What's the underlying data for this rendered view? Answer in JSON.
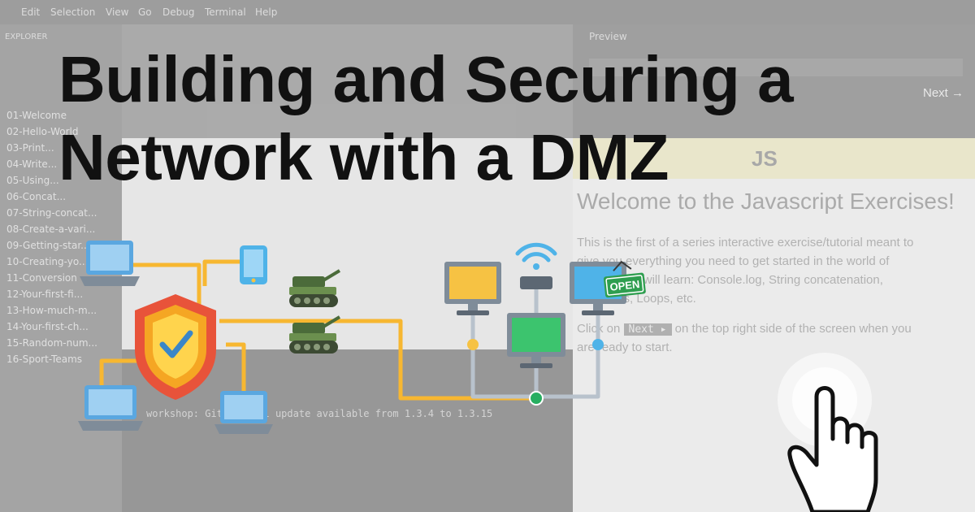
{
  "headline": {
    "line1": "Building and Securing a",
    "line2": "Network with a DMZ"
  },
  "background": {
    "menu": [
      "Edit",
      "Selection",
      "View",
      "Go",
      "Debug",
      "Terminal",
      "Help"
    ],
    "explorer_header": "EXPLORER",
    "files": [
      "01-Welcome",
      "02-Hello-World",
      "03-Print...",
      "04-Write...",
      "05-Using...",
      "06-Concat...",
      "07-String-concat...",
      "08-Create-a-vari...",
      "09-Getting-star...",
      "10-Creating-yo...",
      "11-Conversion",
      "12-Your-first-fi...",
      "13-How-much-m...",
      "14-Your-first-ch...",
      "15-Random-num...",
      "16-Sport-Teams"
    ],
    "terminal_line": "workshop: Gitpod will update available from 1.3.4 to 1.3.15",
    "preview_tab": "Preview",
    "preview_next": "Next →",
    "js_banner": "JS",
    "welcome": "Welcome to the Javascript Exercises!",
    "paragraph": [
      "This is the first of a series interactive exercise/tutorial meant to",
      "give you everything you need to get started in the world of",
      "coding. You will learn: Console.log, String concatenation,",
      "Functions, Loops, etc."
    ],
    "click_prefix": "Click on",
    "next_key": "Next ▸",
    "click_suffix": "on the top right side of the screen when you",
    "click_line2": "are ready to start."
  },
  "diagram": {
    "open_sign": "OPEN"
  },
  "colors": {
    "wire_yellow": "#f7b731",
    "wire_gray": "#b8c2cc",
    "shield_red": "#e8533a",
    "shield_orange": "#f5a623",
    "check_blue": "#3a86c8",
    "laptop_blue": "#5aa7e0",
    "monitor_yellow": "#f6c243",
    "monitor_green": "#3cc46e",
    "monitor_blue": "#4fb3e8",
    "node_green": "#27ae60",
    "tank_green": "#4b6b3a"
  },
  "icons": [
    "laptop-icon",
    "phone-icon",
    "shield-check-icon",
    "tank-icon",
    "wifi-icon",
    "router-icon",
    "monitor-icon",
    "open-sign-icon",
    "hand-pointer-icon"
  ]
}
